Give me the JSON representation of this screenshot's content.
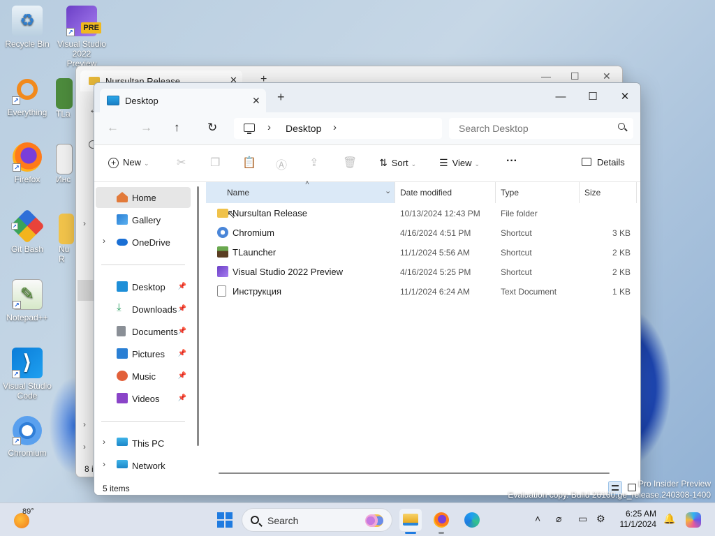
{
  "desktop": {
    "icons": [
      {
        "label": "Recycle Bin",
        "glyph": "♻"
      },
      {
        "label": "Visual Studio 2022 Preview",
        "glyph": "PRE"
      },
      {
        "label": "Everything",
        "glyph": "🔍"
      },
      {
        "label": "Firefox",
        "glyph": "🦊"
      },
      {
        "label": "Git Bash",
        "glyph": "◆"
      },
      {
        "label": "Notepad++",
        "glyph": "✎"
      },
      {
        "label": "Visual Studio Code",
        "glyph": "⟩"
      },
      {
        "label": "Chromium",
        "glyph": "◎"
      }
    ],
    "partial_labels": [
      "TLa",
      "Инс",
      "Nu",
      "R"
    ],
    "watermark_line1": "Pro Insider Preview",
    "watermark_line2": "Evaluation copy. Build 26100.ge_release.240308-1400"
  },
  "back_window": {
    "tab_title": "Nursultan Release",
    "status_partial": "8 i"
  },
  "window": {
    "tab_title": "Desktop",
    "address": {
      "crumb": "Desktop"
    },
    "search": {
      "placeholder": "Search Desktop"
    },
    "commands": {
      "new_label": "New",
      "sort_label": "Sort",
      "view_label": "View",
      "more_label": "···",
      "details_label": "Details"
    },
    "sidebar": {
      "top": [
        {
          "label": "Home",
          "selected": true
        },
        {
          "label": "Gallery"
        },
        {
          "label": "OneDrive",
          "expandable": true
        }
      ],
      "quick_access": [
        {
          "label": "Desktop",
          "color": "#1e8fd8"
        },
        {
          "label": "Downloads",
          "color": "#1f9a5a"
        },
        {
          "label": "Documents",
          "color": "#8a8f96"
        },
        {
          "label": "Pictures",
          "color": "#2a7fd4"
        },
        {
          "label": "Music",
          "color": "#e2603a"
        },
        {
          "label": "Videos",
          "color": "#8a44c8"
        }
      ],
      "bottom": [
        {
          "label": "This PC"
        },
        {
          "label": "Network"
        }
      ]
    },
    "columns": {
      "name": "Name",
      "date": "Date modified",
      "type": "Type",
      "size": "Size"
    },
    "files": [
      {
        "name": "Nursultan Release",
        "date": "10/13/2024 12:43 PM",
        "type": "File folder",
        "size": "",
        "icon": "folder-icon",
        "color": "#f0c24a"
      },
      {
        "name": "Chromium",
        "date": "4/16/2024 4:51 PM",
        "type": "Shortcut",
        "size": "3 KB",
        "icon": "chromium-icon",
        "color": "#4a86d8"
      },
      {
        "name": "TLauncher",
        "date": "11/1/2024 5:56 AM",
        "type": "Shortcut",
        "size": "2 KB",
        "icon": "tlauncher-icon",
        "color": "#3c7a3a"
      },
      {
        "name": "Visual Studio 2022 Preview",
        "date": "4/16/2024 5:25 PM",
        "type": "Shortcut",
        "size": "2 KB",
        "icon": "visual-studio-icon",
        "color": "#8c5bd6"
      },
      {
        "name": "Инструкция",
        "date": "11/1/2024 6:24 AM",
        "type": "Text Document",
        "size": "1 KB",
        "icon": "text-document-icon",
        "color": "#ffffff"
      }
    ],
    "status": "5 items"
  },
  "taskbar": {
    "weather_temp": "89°",
    "search_label": "Search",
    "time": "6:25 AM",
    "date": "11/1/2024"
  }
}
